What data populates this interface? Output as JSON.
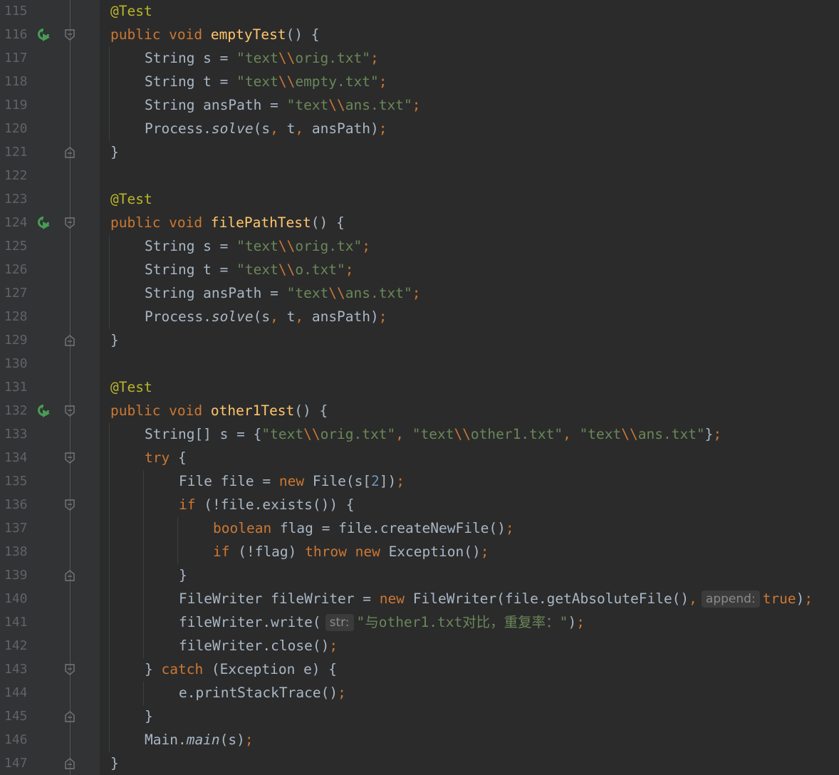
{
  "editor": {
    "lines": [
      {
        "n": "115",
        "text": "@Test"
      },
      {
        "n": "116",
        "text": "public void emptyTest() {"
      },
      {
        "n": "117",
        "text": "String s = \"text\\\\orig.txt\";"
      },
      {
        "n": "118",
        "text": "String t = \"text\\\\empty.txt\";"
      },
      {
        "n": "119",
        "text": "String ansPath = \"text\\\\ans.txt\";"
      },
      {
        "n": "120",
        "text": "Process.solve(s, t, ansPath);"
      },
      {
        "n": "121",
        "text": "}"
      },
      {
        "n": "122",
        "text": ""
      },
      {
        "n": "123",
        "text": "@Test"
      },
      {
        "n": "124",
        "text": "public void filePathTest() {"
      },
      {
        "n": "125",
        "text": "String s = \"text\\\\orig.tx\";"
      },
      {
        "n": "126",
        "text": "String t = \"text\\\\o.txt\";"
      },
      {
        "n": "127",
        "text": "String ansPath = \"text\\\\ans.txt\";"
      },
      {
        "n": "128",
        "text": "Process.solve(s, t, ansPath);"
      },
      {
        "n": "129",
        "text": "}"
      },
      {
        "n": "130",
        "text": ""
      },
      {
        "n": "131",
        "text": "@Test"
      },
      {
        "n": "132",
        "text": "public void other1Test() {"
      },
      {
        "n": "133",
        "text": "String[] s = {\"text\\\\orig.txt\", \"text\\\\other1.txt\", \"text\\\\ans.txt\"};"
      },
      {
        "n": "134",
        "text": "try {"
      },
      {
        "n": "135",
        "text": "File file = new File(s[2]);"
      },
      {
        "n": "136",
        "text": "if (!file.exists()) {"
      },
      {
        "n": "137",
        "text": "boolean flag = file.createNewFile();"
      },
      {
        "n": "138",
        "text": "if (!flag) throw new Exception();"
      },
      {
        "n": "139",
        "text": "}"
      },
      {
        "n": "140",
        "text": "FileWriter fileWriter = new FileWriter(file.getAbsoluteFile(), append: true);"
      },
      {
        "n": "141",
        "text": "fileWriter.write( str: \"与other1.txt对比，重复率：\");"
      },
      {
        "n": "142",
        "text": "fileWriter.close();"
      },
      {
        "n": "143",
        "text": "} catch (Exception e) {"
      },
      {
        "n": "144",
        "text": "e.printStackTrace();"
      },
      {
        "n": "145",
        "text": "}"
      },
      {
        "n": "146",
        "text": "Main.main(s);"
      },
      {
        "n": "147",
        "text": "}"
      }
    ],
    "hints": {
      "append": "append:",
      "str": "str:"
    },
    "icons": {
      "run": "run-test-icon",
      "fold": "fold-marker-icon"
    },
    "colors": {
      "background": "#2b2b2b",
      "gutter": "#313335",
      "keyword": "#cc7832",
      "annotation": "#bbb529",
      "method_decl": "#ffc66d",
      "string": "#6a8759",
      "number": "#6897bb",
      "text": "#a9b7c6",
      "line_number": "#606366"
    }
  }
}
